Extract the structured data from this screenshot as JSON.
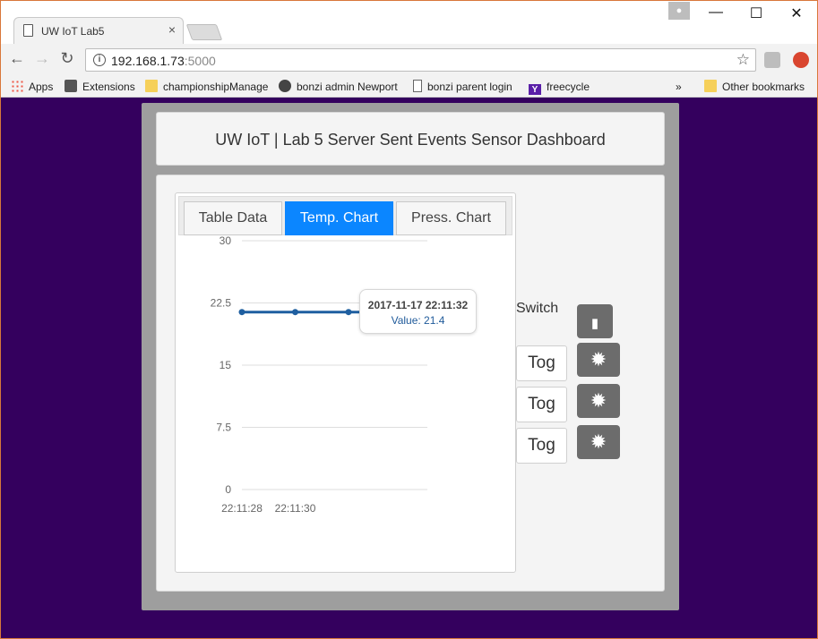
{
  "browser": {
    "tab_title": "UW IoT Lab5",
    "tab_close": "×",
    "url_host": "192.168.1.73",
    "url_port": ":5000",
    "window_min": "—",
    "window_max": "☐",
    "window_close": "✕",
    "back": "←",
    "forward": "→",
    "reload": "↻",
    "star": "☆",
    "info": "i",
    "bookmarks": [
      {
        "label": "Apps",
        "icon": "apps-grid-icon"
      },
      {
        "label": "Extensions",
        "icon": "puzzle-icon"
      },
      {
        "label": "championshipManage",
        "icon": "folder-icon"
      },
      {
        "label": "bonzi admin Newport",
        "icon": "globe-icon"
      },
      {
        "label": "bonzi parent login",
        "icon": "page-icon"
      },
      {
        "label": "freecycle",
        "icon": "yahoo-icon"
      }
    ],
    "bookmarks_more": "»",
    "other_bookmarks": "Other bookmarks"
  },
  "header": {
    "title": "UW IoT | Lab 5 Server Sent Events Sensor Dashboard"
  },
  "tabs": [
    {
      "label": "Table Data",
      "active": false
    },
    {
      "label": "Temp. Chart",
      "active": true
    },
    {
      "label": "Press. Chart",
      "active": false
    }
  ],
  "chart_data": {
    "type": "line",
    "title": "",
    "xlabel": "",
    "ylabel": "",
    "ylim": [
      0,
      30
    ],
    "yticks": [
      "0",
      "7.5",
      "15",
      "22.5",
      "30"
    ],
    "xticks": [
      "22:11:28",
      "22:11:30"
    ],
    "x": [
      "22:11:28",
      "22:11:30",
      "22:11:32",
      "22:11:34"
    ],
    "series": [
      {
        "values": [
          21.4,
          21.4,
          21.4,
          21.4
        ],
        "color": "#1f5fa0"
      }
    ],
    "grid": true,
    "tooltip": {
      "time": "2017-11-17 22:11:32",
      "value": "Value: 21.4"
    }
  },
  "controls": {
    "switch_label": "Switch",
    "toggle_buttons": [
      "Tog",
      "Tog",
      "Tog"
    ],
    "switch_icon": "switch-icon",
    "light_icons": [
      "light-icon",
      "light-icon",
      "light-icon"
    ]
  },
  "colors": {
    "page_bg": "#34005e",
    "active_tab": "#0b86ff",
    "series": "#1f5fa0",
    "icon_button": "#6c6c6c"
  }
}
